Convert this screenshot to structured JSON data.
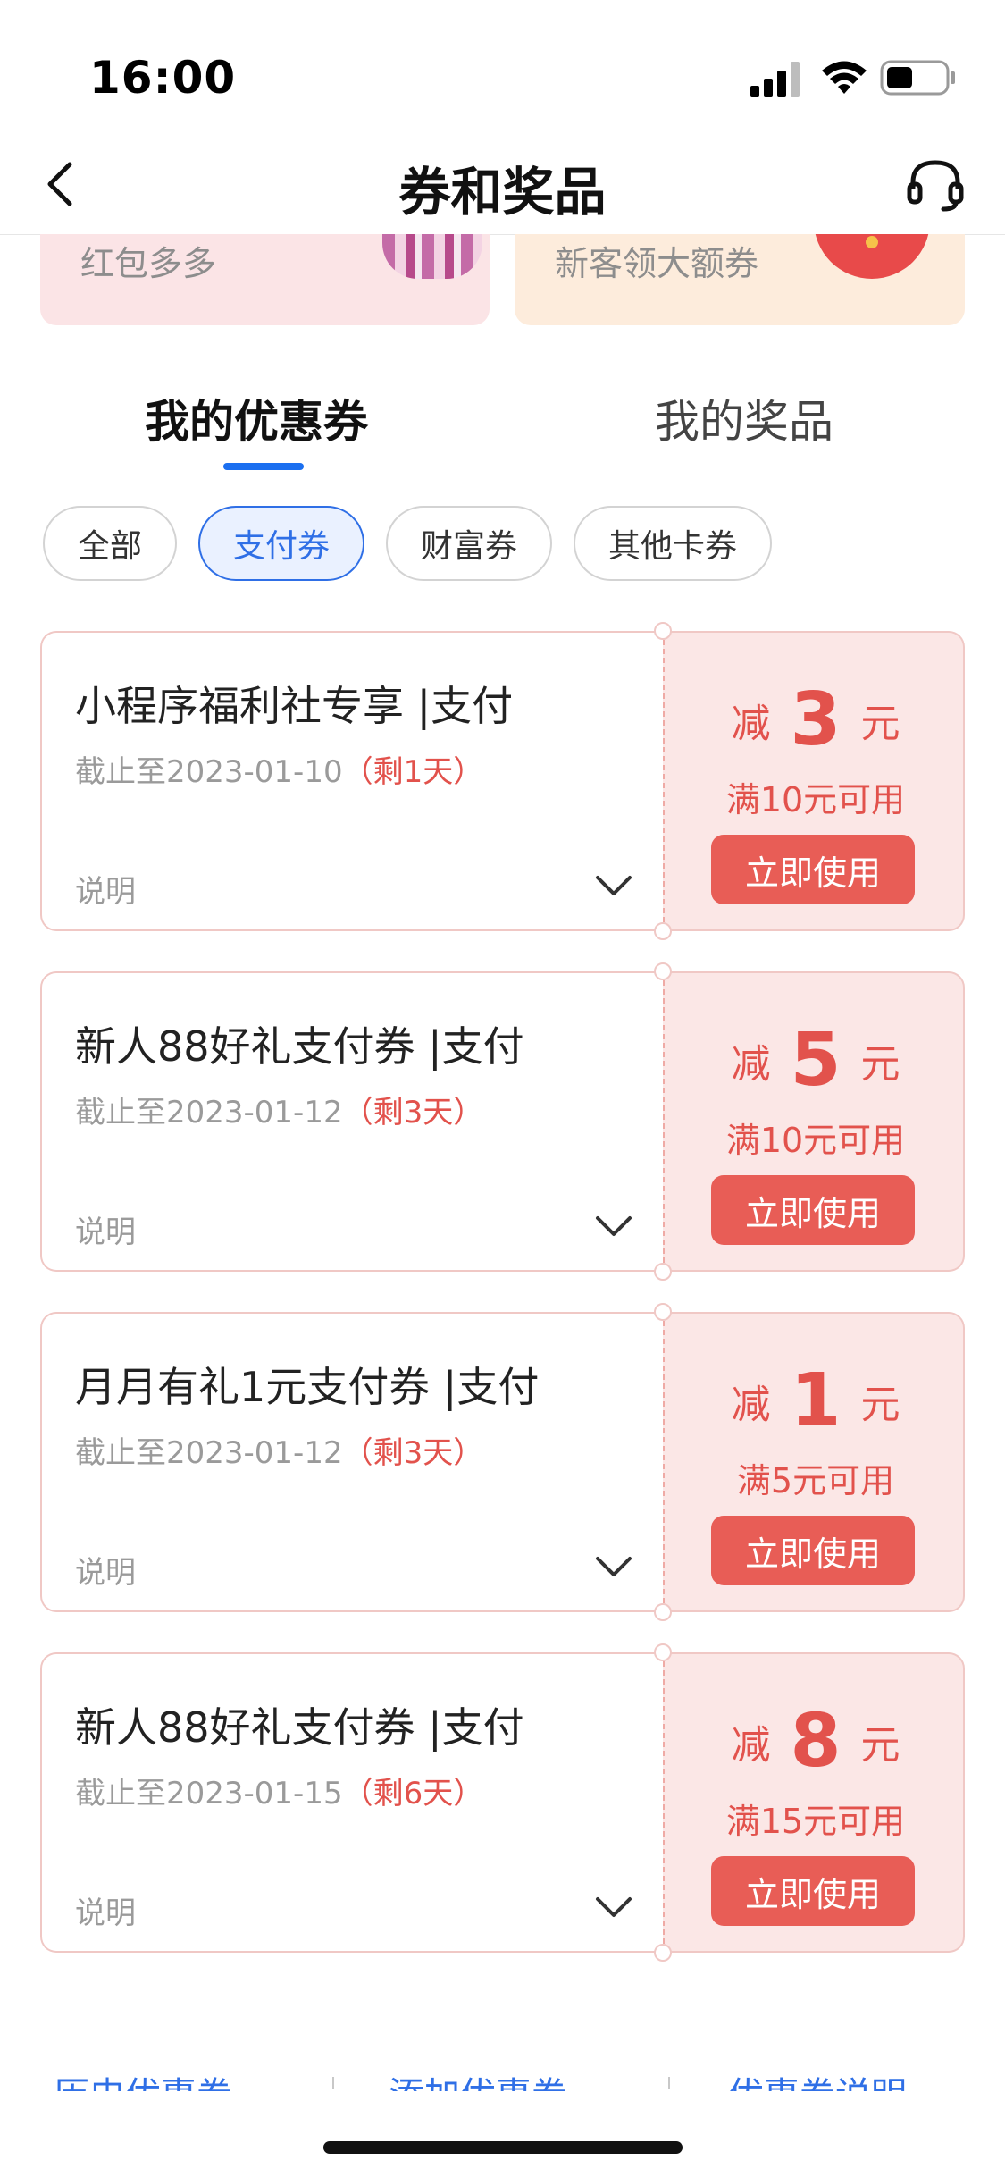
{
  "status_bar": {
    "time": "16:00"
  },
  "nav": {
    "title": "券和奖品"
  },
  "banners": [
    {
      "text": "红包多多"
    },
    {
      "text": "新客领大额券"
    }
  ],
  "tabs": [
    {
      "label": "我的优惠券",
      "active": true
    },
    {
      "label": "我的奖品",
      "active": false
    }
  ],
  "filters": [
    {
      "label": "全部",
      "active": false
    },
    {
      "label": "支付券",
      "active": true
    },
    {
      "label": "财富券",
      "active": false
    },
    {
      "label": "其他卡券",
      "active": false
    }
  ],
  "coupons": [
    {
      "title": "小程序福利社专享 |支付",
      "date": "截止至2023-01-10",
      "remaining": "（剩1天）",
      "desc": "说明",
      "prefix": "减",
      "amount": "3",
      "unit": "元",
      "condition": "满10元可用",
      "button": "立即使用"
    },
    {
      "title": "新人88好礼支付券 |支付",
      "date": "截止至2023-01-12",
      "remaining": "（剩3天）",
      "desc": "说明",
      "prefix": "减",
      "amount": "5",
      "unit": "元",
      "condition": "满10元可用",
      "button": "立即使用"
    },
    {
      "title": "月月有礼1元支付券 |支付",
      "date": "截止至2023-01-12",
      "remaining": "（剩3天）",
      "desc": "说明",
      "prefix": "减",
      "amount": "1",
      "unit": "元",
      "condition": "满5元可用",
      "button": "立即使用"
    },
    {
      "title": "新人88好礼支付券 |支付",
      "date": "截止至2023-01-15",
      "remaining": "（剩6天）",
      "desc": "说明",
      "prefix": "减",
      "amount": "8",
      "unit": "元",
      "condition": "满15元可用",
      "button": "立即使用"
    }
  ],
  "bottom_links": [
    {
      "label": "历史优惠券"
    },
    {
      "label": "添加优惠券"
    },
    {
      "label": "优惠券说明"
    }
  ],
  "colors": {
    "accent": "#2f6fe6",
    "coupon_red": "#e2524c",
    "coupon_bg": "#fbe7e6"
  },
  "icons": {
    "back": "chevron-left-icon",
    "support": "headset-icon",
    "expand": "chevron-down-icon"
  }
}
